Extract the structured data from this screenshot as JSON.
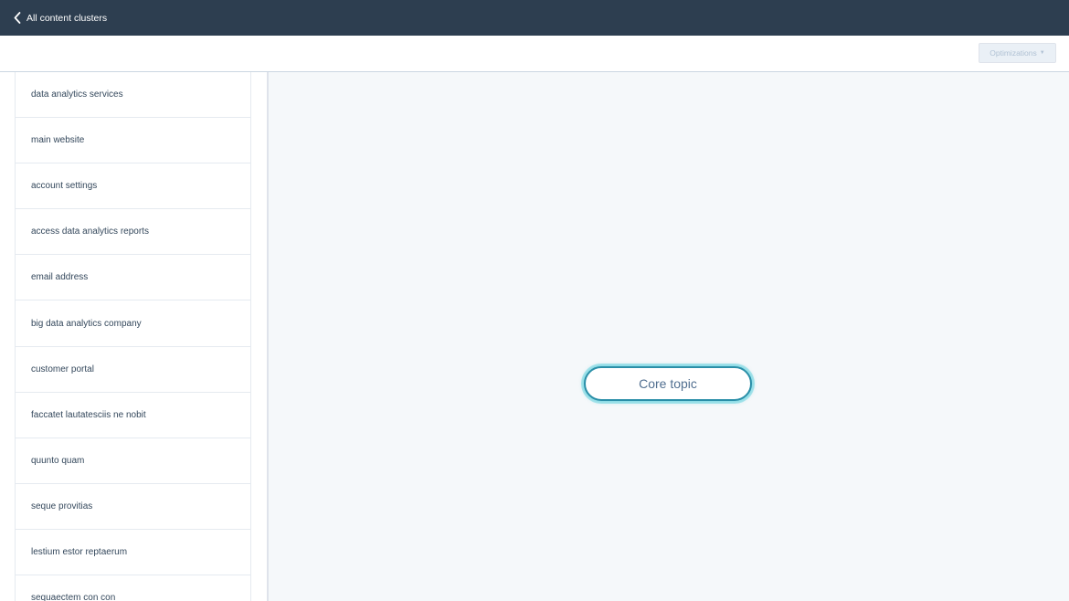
{
  "header": {
    "back_label": "All content clusters"
  },
  "toolbar": {
    "optimizations_label": "Optimizations"
  },
  "sidebar": {
    "items": [
      {
        "label": "data analytics services"
      },
      {
        "label": "main website"
      },
      {
        "label": "account settings"
      },
      {
        "label": "access data analytics reports"
      },
      {
        "label": "email address"
      },
      {
        "label": "big data analytics company"
      },
      {
        "label": "customer portal"
      },
      {
        "label": "faccatet lautatesciis ne nobit"
      },
      {
        "label": "quunto quam"
      },
      {
        "label": "seque provitias"
      },
      {
        "label": "lestium estor reptaerum"
      },
      {
        "label": "sequaectem con con"
      }
    ]
  },
  "canvas": {
    "core_topic_label": "Core topic"
  },
  "colors": {
    "topbar": "#2d3e50",
    "canvas_bg": "#f5f8fa",
    "node_border": "#2a8fa8",
    "node_glow": "#00bdd2"
  },
  "icons": {
    "back": "chevron-left-icon",
    "dropdown": "caret-down-icon"
  }
}
